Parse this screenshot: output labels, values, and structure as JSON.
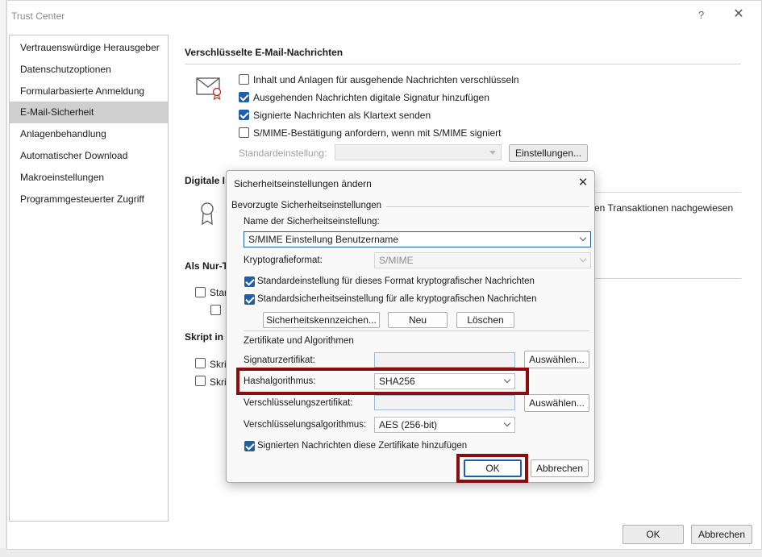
{
  "window": {
    "title": "Trust Center",
    "help_glyph": "?",
    "close_glyph": "✕",
    "ok_label": "OK",
    "cancel_label": "Abbrechen"
  },
  "sidebar": {
    "items": [
      {
        "label": "Vertrauenswürdige Herausgeber",
        "selected": false
      },
      {
        "label": "Datenschutzoptionen",
        "selected": false
      },
      {
        "label": "Formularbasierte Anmeldung",
        "selected": false
      },
      {
        "label": "E-Mail-Sicherheit",
        "selected": true
      },
      {
        "label": "Anlagenbehandlung",
        "selected": false
      },
      {
        "label": "Automatischer Download",
        "selected": false
      },
      {
        "label": "Makroeinstellungen",
        "selected": false
      },
      {
        "label": "Programmgesteuerter Zugriff",
        "selected": false
      }
    ]
  },
  "main": {
    "encrypted_section": {
      "title": "Verschlüsselte E-Mail-Nachrichten",
      "options": [
        {
          "label": "Inhalt und Anlagen für ausgehende Nachrichten verschlüsseln",
          "checked": false
        },
        {
          "label": "Ausgehenden Nachrichten digitale Signatur hinzufügen",
          "checked": true
        },
        {
          "label": "Signierte Nachrichten als Klartext senden",
          "checked": true
        },
        {
          "label": "S/MIME-Bestätigung anfordern, wenn mit S/MIME signiert",
          "checked": false
        }
      ],
      "default_setting_label": "Standardeinstellung:",
      "default_setting_value": "",
      "settings_button": "Einstellungen..."
    },
    "digital_section": {
      "title_partial": "Digitale I",
      "text_partial": "en Transaktionen nachgewiesen"
    },
    "readonly_section": {
      "title_partial": "Als Nur-T",
      "item1_partial": "Star"
    },
    "script_section": {
      "title_partial": "Skript in",
      "item1_partial": "Skri",
      "item2_partial": "Skri"
    }
  },
  "dialog": {
    "title": "Sicherheitseinstellungen ändern",
    "close_glyph": "✕",
    "group1_title": "Bevorzugte Sicherheitseinstellungen",
    "name_label": "Name der Sicherheitseinstellung:",
    "name_value": "S/MIME Einstellung Benutzername",
    "crypto_format_label": "Kryptografieformat:",
    "crypto_format_value": "S/MIME",
    "checkbox1": "Standardeinstellung für dieses Format kryptografischer Nachrichten",
    "checkbox2": "Standardsicherheitseinstellung für alle kryptografischen Nachrichten",
    "security_labels_button": "Sicherheitskennzeichen...",
    "new_button": "Neu",
    "delete_button": "Löschen",
    "group2_title": "Zertifikate und Algorithmen",
    "signing_cert_label": "Signaturzertifikat:",
    "signing_cert_value": "",
    "choose_button": "Auswählen...",
    "hash_label": "Hashalgorithmus:",
    "hash_value": "SHA256",
    "enc_cert_label": "Verschlüsselungszertifikat:",
    "enc_cert_value": "",
    "enc_algo_label": "Verschlüsselungsalgorithmus:",
    "enc_algo_value": "AES (256-bit)",
    "send_certs_checkbox": "Signierten Nachrichten diese Zertifikate hinzufügen",
    "ok_button": "OK",
    "cancel_button": "Abbrechen"
  },
  "colors": {
    "highlight_box": "#8b0d0d",
    "checkbox_checked": "#1f5fa7",
    "sidebar_selected": "#cfcfcf"
  }
}
